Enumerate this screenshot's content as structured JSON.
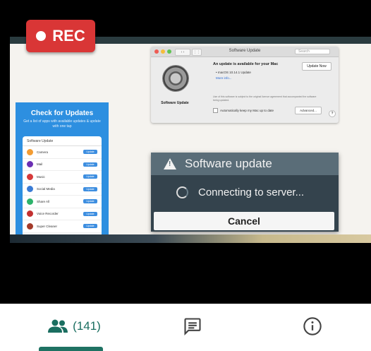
{
  "recording": {
    "label": "REC"
  },
  "screen_share": {
    "blue_panel": {
      "title": "Check for Updates",
      "subtitle": "Get a list of apps with available updates & update with one tap",
      "list_header": "Software Update",
      "apps": [
        {
          "name": "Camera",
          "version": "",
          "button": "Update",
          "color": "#f39c33"
        },
        {
          "name": "Mail",
          "version": "",
          "button": "Update",
          "color": "#6b2fb3"
        },
        {
          "name": "Music",
          "version": "",
          "button": "Update",
          "color": "#d63a3a"
        },
        {
          "name": "Social Media",
          "version": "",
          "button": "Update",
          "color": "#3a7bd5"
        },
        {
          "name": "Share All",
          "version": "",
          "button": "Update",
          "color": "#2db36b"
        },
        {
          "name": "Voice Recorder",
          "version": "",
          "button": "Update",
          "color": "#c23030"
        },
        {
          "name": "Super Cleaner",
          "version": "",
          "button": "Update",
          "color": "#a33a2a"
        }
      ]
    },
    "mac_window": {
      "title": "Software Update",
      "search_placeholder": "Search",
      "icon_label": "Software Update",
      "update_title": "An update is available for your Mac",
      "update_now": "Update Now",
      "update_item": "• macOS 10.14.1 Update",
      "more_info": "More info...",
      "legal": "Use of this software is subject to the original licence agreement that accompanied the software being updated.",
      "auto_update": "Automatically keep my Mac up to date",
      "advanced": "Advanced...",
      "help": "?"
    },
    "android_dialog": {
      "title": "Software update",
      "message": "Connecting to server...",
      "cancel": "Cancel"
    }
  },
  "tabs": {
    "participants_count": "(141)",
    "icons": [
      "people-icon",
      "chat-icon",
      "info-icon"
    ]
  }
}
